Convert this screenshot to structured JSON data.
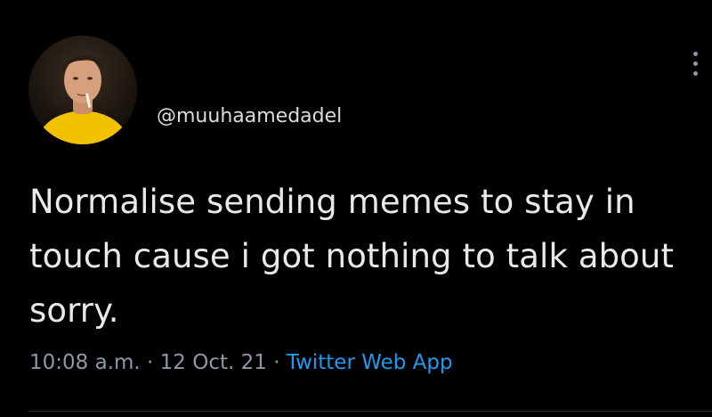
{
  "tweet": {
    "handle": "@muuhaamedadel",
    "text": "Normalise sending memes to stay in touch cause i got nothing to talk about sorry.",
    "time": "10:08 a.m.",
    "separator": "·",
    "date": "12 Oct. 21",
    "source": "Twitter Web App"
  },
  "icons": {
    "more": "more-options-icon"
  },
  "colors": {
    "background": "#000000",
    "text": "#e7e9ea",
    "secondary": "#8b98a5",
    "link": "#1d9bf0",
    "avatar_shirt": "#f2c200"
  }
}
